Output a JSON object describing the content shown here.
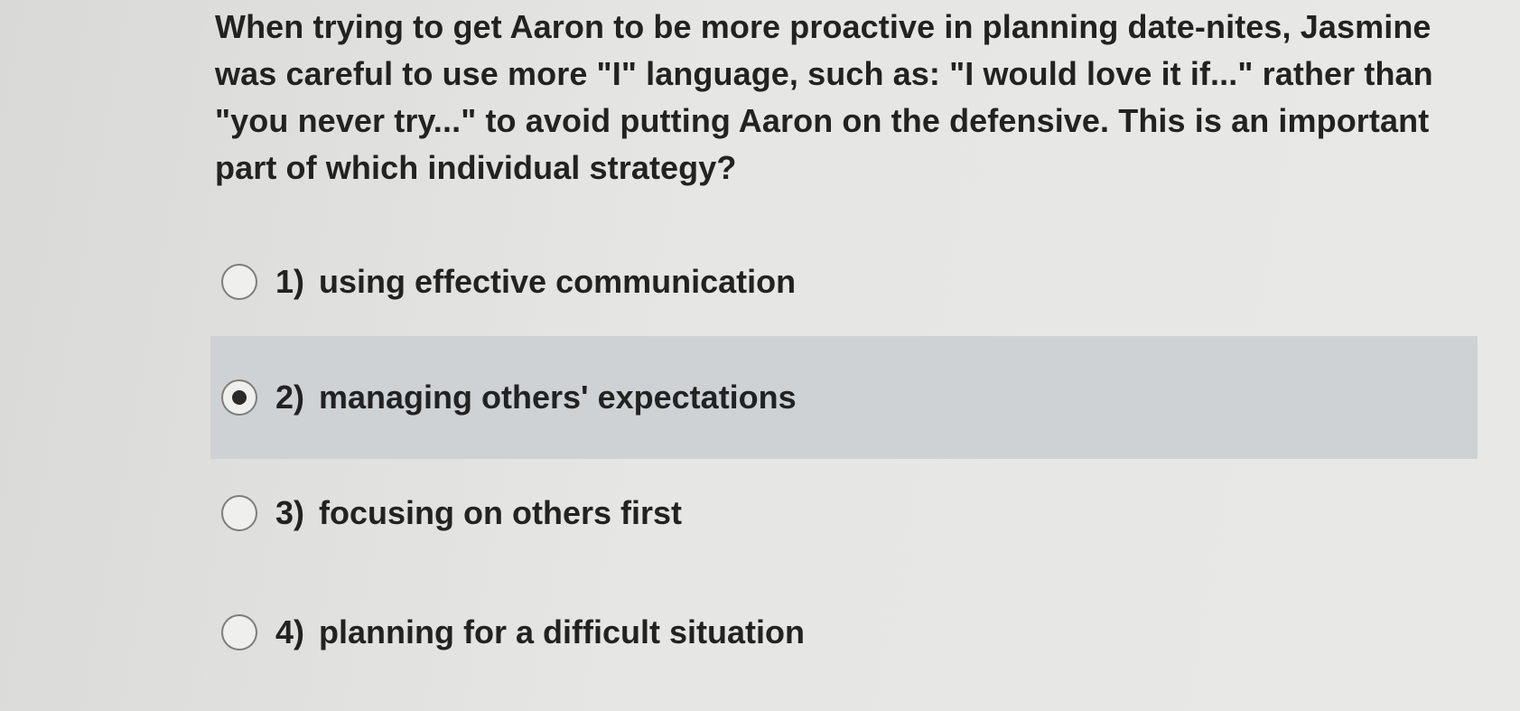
{
  "question": {
    "text": "When trying to get Aaron to be more proactive in planning date-nites, Jasmine was careful to use more \"I\" language, such as: \"I would love it if...\" rather than \"you never try...\" to avoid putting Aaron on the defensive. This is an important part of which individual strategy?"
  },
  "options": [
    {
      "number": "1)",
      "label": "using effective communication",
      "selected": false
    },
    {
      "number": "2)",
      "label": "managing others' expectations",
      "selected": true
    },
    {
      "number": "3)",
      "label": "focusing on others first",
      "selected": false
    },
    {
      "number": "4)",
      "label": "planning for a difficult situation",
      "selected": false
    }
  ],
  "colors": {
    "selected_background": "#cfd2d5",
    "page_background": "#e4e4e2",
    "text": "#222222"
  }
}
